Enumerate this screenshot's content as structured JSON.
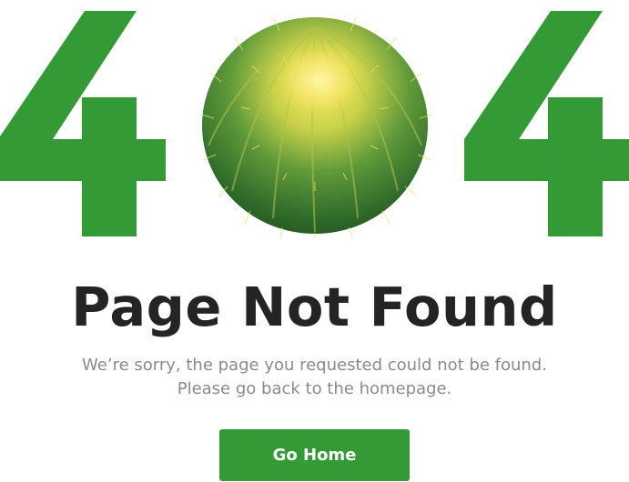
{
  "hero": {
    "digit_left": "4",
    "digit_right": "4",
    "middle_graphic": "cactus-image",
    "accent_color": "#349a35"
  },
  "title": "Page Not Found",
  "message": {
    "line1": "We’re sorry, the page you requested could not be found.",
    "line2": "Please go back to the homepage."
  },
  "button": {
    "label": "Go Home"
  }
}
